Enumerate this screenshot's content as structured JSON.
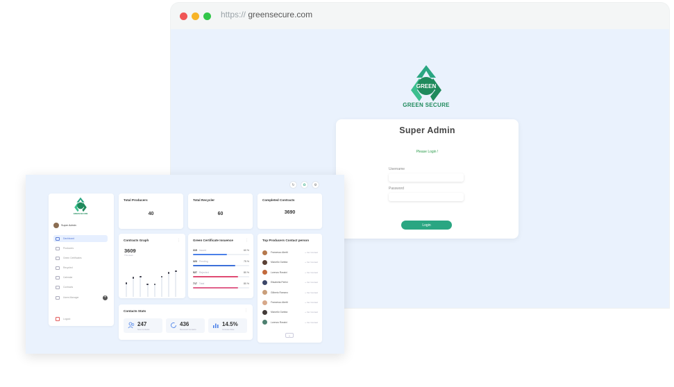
{
  "browser": {
    "url_scheme": "https://",
    "url_host": "greensecure.com",
    "window_dots": [
      "#f05656",
      "#f7b428",
      "#32c64a"
    ]
  },
  "brand": {
    "name": "GREEN SECURE",
    "logo_word": "GREEN",
    "color": "#1f8a5c"
  },
  "login": {
    "title": "Super Admin",
    "subtitle": "Please Login !",
    "username_label": "Username",
    "password_label": "Password",
    "button_label": "Login"
  },
  "dashboard": {
    "top_icons": [
      "refresh-icon",
      "recycle-icon",
      "settings-icon"
    ],
    "sidebar": {
      "logo_text": "GREEN SECURE",
      "user_name": "Super Admin",
      "items": [
        {
          "label": "Dashboard",
          "active": true
        },
        {
          "label": "Producers",
          "active": false
        },
        {
          "label": "Green Certificates",
          "active": false
        },
        {
          "label": "Recycled",
          "active": false
        },
        {
          "label": "Calendar",
          "active": false
        },
        {
          "label": "Contracts",
          "active": false
        },
        {
          "label": "Users Manager",
          "active": false
        }
      ],
      "logout_label": "Logout"
    },
    "stats_cards": [
      {
        "title": "Total Producers",
        "value": "40"
      },
      {
        "title": "Total Recycler",
        "value": "60"
      },
      {
        "title": "Completed Contracts",
        "value": "3690"
      }
    ],
    "contracts_graph": {
      "title": "Contracts Graph",
      "total": "3609",
      "caption": "This week",
      "levels": [
        0.35,
        0.5,
        0.52,
        0.32,
        0.32,
        0.52,
        0.62,
        0.67
      ]
    },
    "green_certificates": {
      "title": "Green Certificate Issuence",
      "rows": [
        {
          "value": "315",
          "label": "Issued",
          "pct": "60 %",
          "level": 0.6,
          "color": "#4a80e8"
        },
        {
          "value": "323",
          "label": "Pending",
          "pct": "75 %",
          "level": 0.75,
          "color": "#3b6fd9"
        },
        {
          "value": "527",
          "label": "Rejected",
          "pct": "80 %",
          "level": 0.8,
          "color": "#e04a72"
        },
        {
          "value": "717",
          "label": "Total",
          "pct": "80 %",
          "level": 0.8,
          "color": "#e0608a"
        }
      ]
    },
    "top_producers": {
      "title": "Top Producers Contact person",
      "rows": [
        {
          "name": "Francesco Abetti",
          "contact": "+ Ver Contact",
          "color": "#b5784c"
        },
        {
          "name": "Marcello Gamba",
          "contact": "+ Ver Contact",
          "color": "#5a4035"
        },
        {
          "name": "Lorenzo Rossini",
          "contact": "+ Ver Contact",
          "color": "#c2693c"
        },
        {
          "name": "Elisabetta Perlini",
          "contact": "+ Ver Contact",
          "color": "#3c4668"
        },
        {
          "name": "Gilberto Romano",
          "contact": "+ Ver Contact",
          "color": "#c99e7a"
        },
        {
          "name": "Francesco Abetti",
          "contact": "+ Ver Contact",
          "color": "#d7a88a"
        },
        {
          "name": "Marcello Gamba",
          "contact": "+ Ver Contact",
          "color": "#423a38"
        },
        {
          "name": "Lorenzo Rossini",
          "contact": "+ Ver Contact",
          "color": "#4e8070"
        }
      ]
    },
    "contacts_stats": {
      "title": "Contacts Stats",
      "items": [
        {
          "value": "247",
          "caption": "New Contacts",
          "icon": "users-icon"
        },
        {
          "value": "436",
          "caption": "Renewed Contacts",
          "icon": "refresh-circle-icon"
        },
        {
          "value": "14.5%",
          "caption": "Increase Rate",
          "icon": "bar-chart-icon"
        }
      ]
    }
  }
}
